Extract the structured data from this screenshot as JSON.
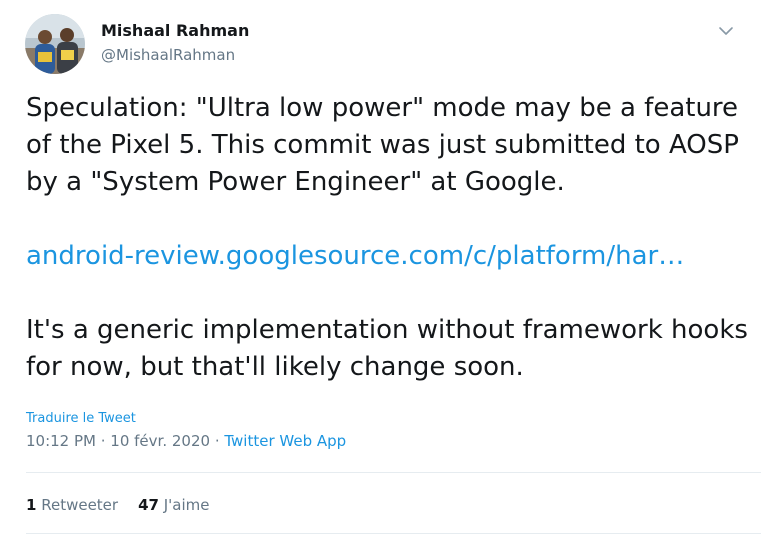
{
  "author": {
    "name": "Mishaal Rahman",
    "handle": "@MishaalRahman",
    "avatar_icon": "profile-photo"
  },
  "menu_icon": "chevron-down-icon",
  "tweet": {
    "lines": [
      "Speculation: \"Ultra low power\" mode may be a feature",
      "of the Pixel 5. This commit was just submitted to AOSP",
      "by a \"System Power Engineer\" at Google."
    ],
    "link": "android-review.googlesource.com/c/platform/har…",
    "lines2": [
      "It's a generic implementation without framework hooks",
      "for now, but that'll likely change soon."
    ]
  },
  "translate_label": "Traduire le Tweet",
  "meta": {
    "time": "10:12 PM",
    "separator": " · ",
    "date": "10 févr. 2020",
    "app": "Twitter Web App"
  },
  "stats": {
    "retweets_count": "1",
    "retweets_label": "Retweeter",
    "likes_count": "47",
    "likes_label": "J'aime"
  },
  "colors": {
    "link": "#1b95e0",
    "secondary": "#657786",
    "text": "#14171a",
    "divider": "#e6ecf0"
  }
}
